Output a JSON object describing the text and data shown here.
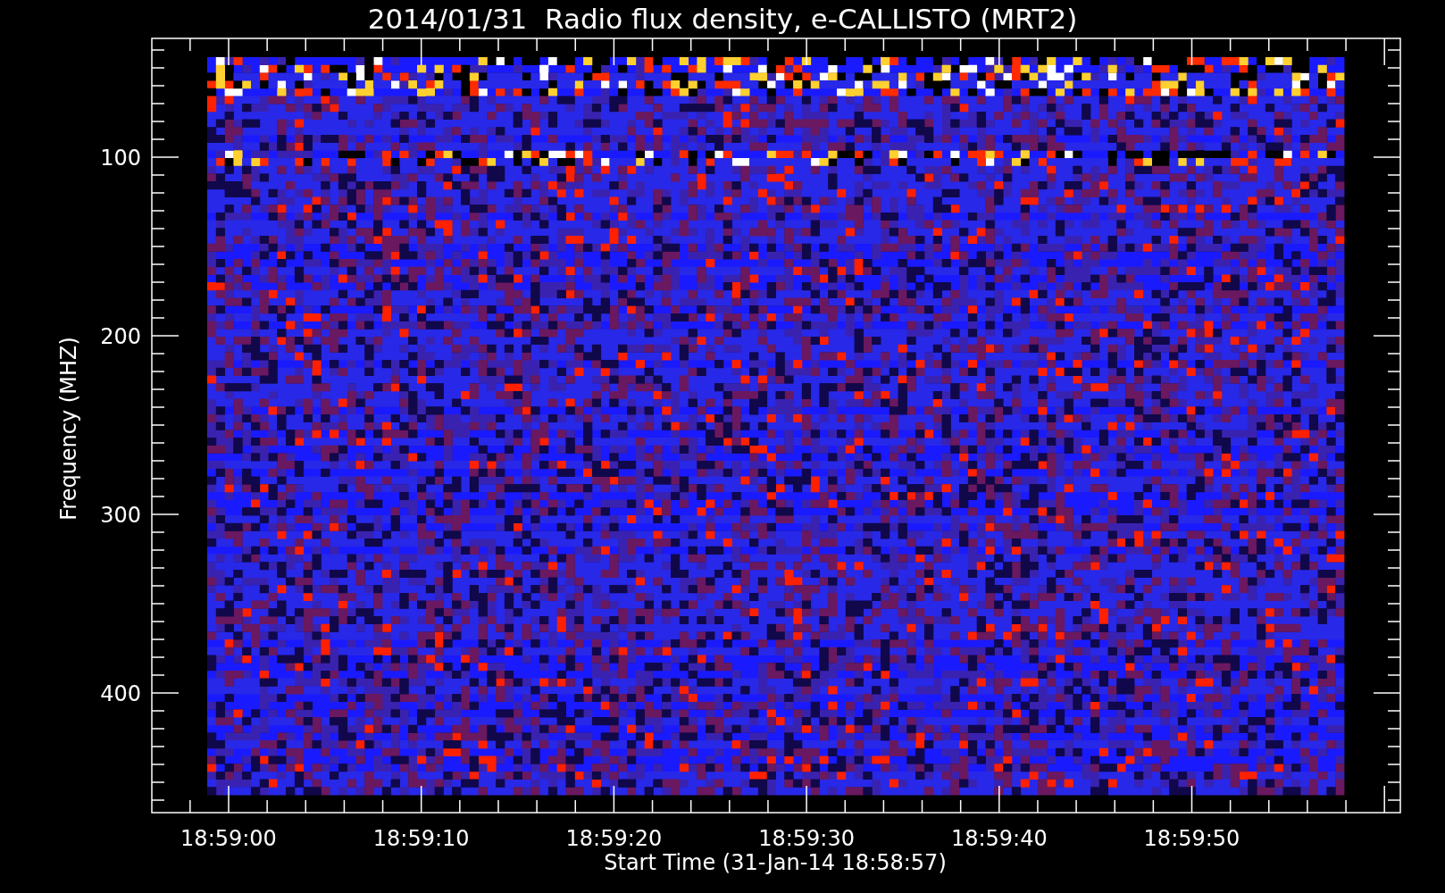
{
  "title": "2014/01/31  Radio flux density, e-CALLISTO (MRT2)",
  "y_axis": {
    "label": "Frequency (MHZ)",
    "ticks": [
      "100",
      "200",
      "300",
      "400"
    ]
  },
  "x_axis": {
    "label": "Start Time (31-Jan-14 18:58:57)",
    "ticks": [
      "18:59:00",
      "18:59:10",
      "18:59:20",
      "18:59:30",
      "18:59:40",
      "18:59:50"
    ]
  }
}
